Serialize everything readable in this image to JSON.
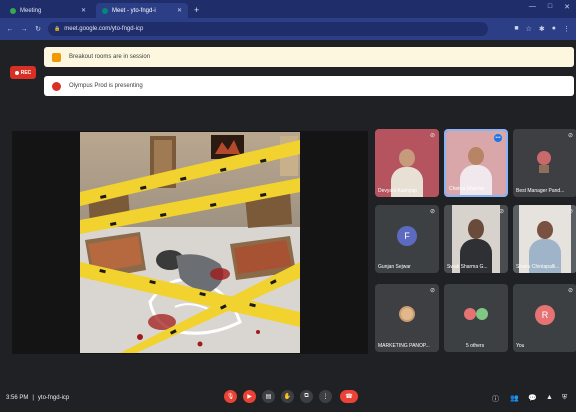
{
  "browser": {
    "tabs": [
      {
        "label": "Meeting",
        "active": false
      },
      {
        "label": "Meet - yto-fngd-i",
        "active": true
      }
    ],
    "new_tab": "+",
    "url": "meet.google.com/yto-fngd-icp",
    "window_controls": [
      "—",
      "□",
      "✕"
    ]
  },
  "recording_badge": "REC",
  "banners": [
    {
      "text": "Breakout rooms are in session"
    },
    {
      "text": "Olympus Prod is presenting"
    }
  ],
  "participants": [
    {
      "name": "Devyani Kashyap",
      "tile": "video",
      "bg": "#b5535e"
    },
    {
      "name": "Chetna Sharma",
      "tile": "video",
      "bg": "#d9a6a9",
      "highlight": true
    },
    {
      "name": "Best Manager Pand...",
      "tile": "video",
      "bg": "#3d3f42"
    },
    {
      "name": "Gunjan Sejwar",
      "tile": "avatar",
      "initial": "F",
      "avatar_color": "#5c6bc0"
    },
    {
      "name": "Swati Sharma G...",
      "tile": "video",
      "bg": "#4a4d50"
    },
    {
      "name": "Shanu Chintapalli...",
      "tile": "video",
      "bg": "#5a5f63"
    },
    {
      "name": "MARKETING PANOP...",
      "tile": "video",
      "bg": "#3d3f42"
    },
    {
      "name": "5 others",
      "tile": "others"
    },
    {
      "name": "You",
      "tile": "avatar",
      "initial": "R",
      "avatar_color": "#e57373"
    }
  ],
  "meeting_info": {
    "time": "3:56 PM",
    "sep": "|",
    "code": "yto-fngd-icp"
  },
  "controls": [
    "mic-off",
    "camera-off",
    "captions",
    "raise-hand",
    "present",
    "more",
    "end-call"
  ],
  "right_controls": [
    "info",
    "people",
    "chat",
    "activities",
    "shield"
  ],
  "colors": {
    "accent_red": "#ea4335",
    "tab_bar": "#1f2d6b",
    "meet_bg": "#202124",
    "tape_yellow": "#f2d22e"
  }
}
